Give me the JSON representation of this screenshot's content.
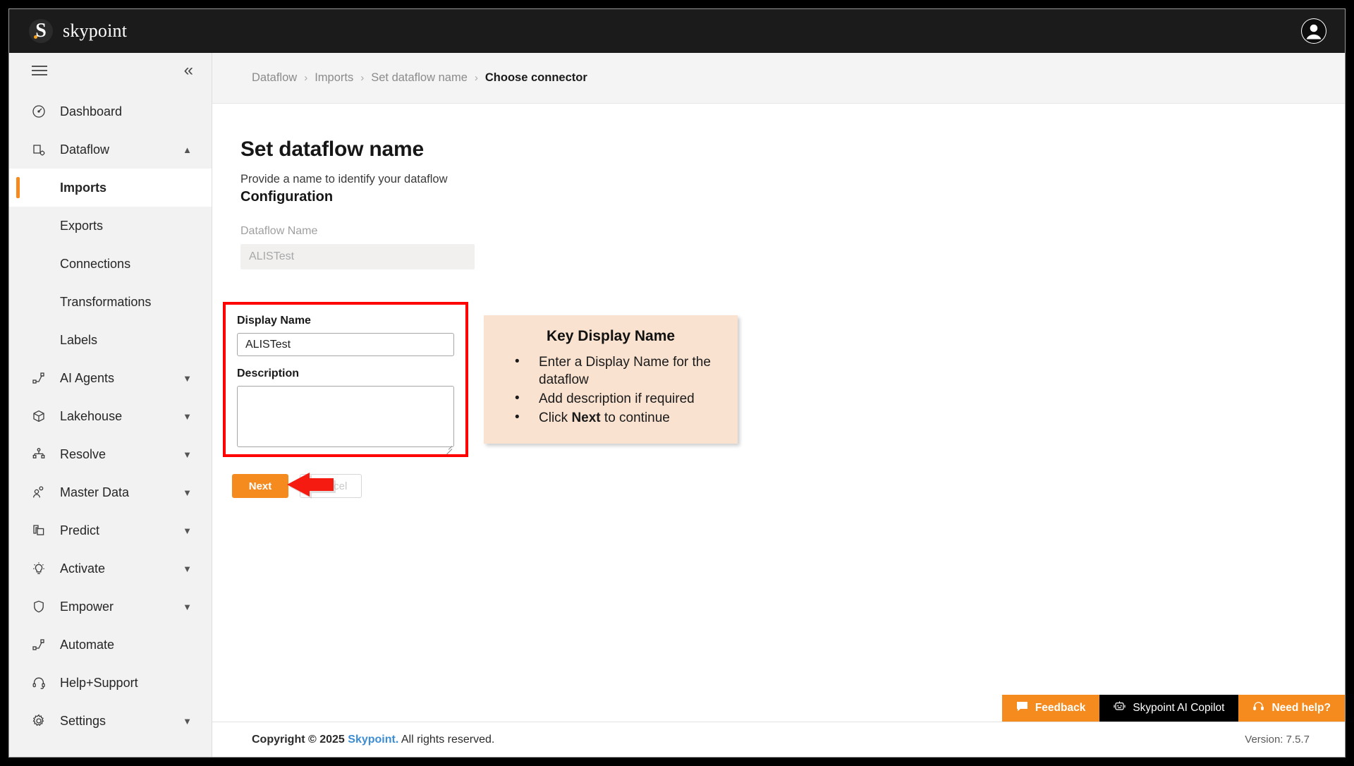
{
  "topbar": {
    "brand_letter": "S",
    "brand_name": "skypoint",
    "avatar_icon": "user-avatar-icon"
  },
  "sidebar": {
    "menu_icon": "hamburger-menu-icon",
    "collapse_icon": "chevron-double-left-icon",
    "items": [
      {
        "label": "Dashboard",
        "icon": "gauge-icon",
        "chevron": ""
      },
      {
        "label": "Dataflow",
        "icon": "dataflow-icon",
        "chevron": "⌃"
      },
      {
        "label": "AI Agents",
        "icon": "ai-agents-icon",
        "chevron": "⌄"
      },
      {
        "label": "Lakehouse",
        "icon": "cube-icon",
        "chevron": "⌄"
      },
      {
        "label": "Resolve",
        "icon": "resolve-icon",
        "chevron": "⌄"
      },
      {
        "label": "Master Data",
        "icon": "person-network-icon",
        "chevron": "⌄"
      },
      {
        "label": "Predict",
        "icon": "layers-icon",
        "chevron": "⌄"
      },
      {
        "label": "Activate",
        "icon": "lightbulb-icon",
        "chevron": "⌄"
      },
      {
        "label": "Empower",
        "icon": "shield-icon",
        "chevron": "⌄"
      },
      {
        "label": "Automate",
        "icon": "automate-icon",
        "chevron": ""
      },
      {
        "label": "Help+Support",
        "icon": "headset-icon",
        "chevron": ""
      },
      {
        "label": "Settings",
        "icon": "gear-icon",
        "chevron": "⌄"
      }
    ],
    "sub_items": [
      {
        "label": "Imports",
        "active": true
      },
      {
        "label": "Exports",
        "active": false
      },
      {
        "label": "Connections",
        "active": false
      },
      {
        "label": "Transformations",
        "active": false
      },
      {
        "label": "Labels",
        "active": false
      }
    ]
  },
  "breadcrumb": {
    "separator": "›",
    "items": [
      {
        "label": "Dataflow",
        "current": false
      },
      {
        "label": "Imports",
        "current": false
      },
      {
        "label": "Set dataflow name",
        "current": false
      },
      {
        "label": "Choose connector",
        "current": true
      }
    ]
  },
  "page": {
    "title": "Set dataflow name",
    "subtitle": "Provide a name to identify your dataflow",
    "section_label": "Configuration",
    "dataflow_name_label": "Dataflow Name",
    "dataflow_name_value": "ALISTest",
    "display_name_label": "Display Name",
    "display_name_value": "ALISTest",
    "description_label": "Description",
    "description_value": "",
    "next_label": "Next",
    "cancel_label": "Cancel"
  },
  "callout": {
    "title": "Key Display Name",
    "bullets": [
      {
        "pre": "Enter a Display Name for the dataflow",
        "bold": "",
        "post": ""
      },
      {
        "pre": "Add description if required",
        "bold": "",
        "post": ""
      },
      {
        "pre": "Click ",
        "bold": "Next",
        "post": " to continue"
      }
    ]
  },
  "widgets": {
    "feedback_label": "Feedback",
    "feedback_icon": "chat-bubble-icon",
    "copilot_label": "Skypoint AI Copilot",
    "copilot_icon": "robot-icon",
    "help_label": "Need help?",
    "help_icon": "headset-icon"
  },
  "footer": {
    "copyright_prefix": "Copyright © 2025",
    "copyright_brand": "Skypoint.",
    "copyright_suffix": "All rights reserved.",
    "version": "Version: 7.5.7"
  },
  "colors": {
    "accent_orange": "#f58b1f",
    "highlight_red": "#fe0000",
    "callout_bg": "#fae2d0",
    "link_blue": "#3c8dd4",
    "topbar_black": "#1b1b1b"
  }
}
